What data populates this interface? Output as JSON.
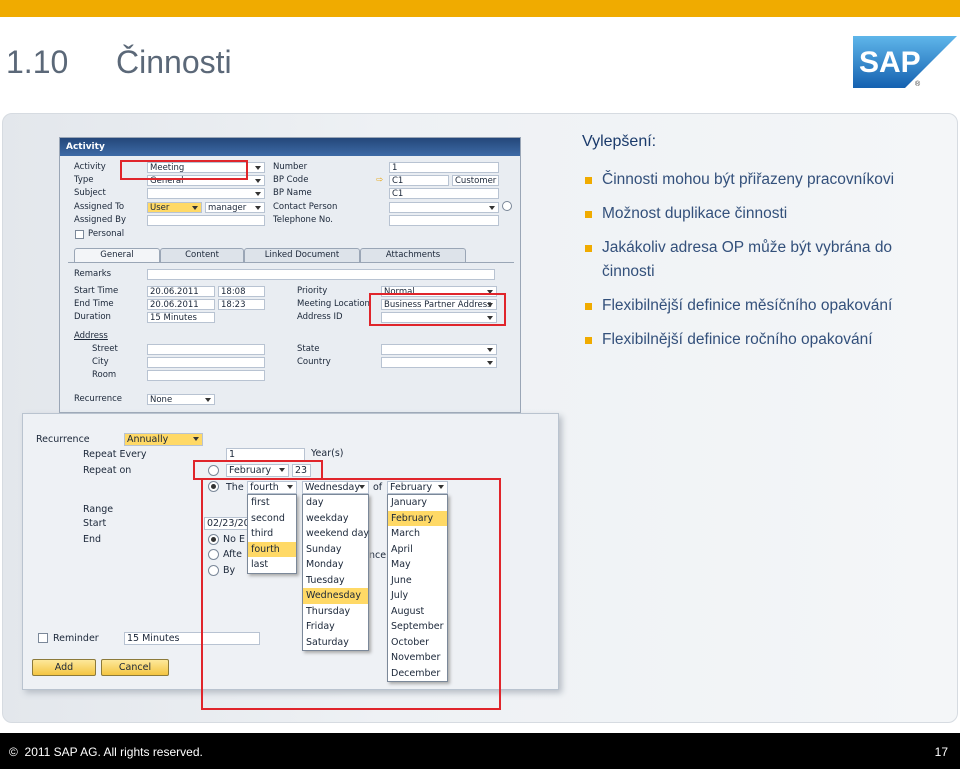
{
  "slide": {
    "number": "1.10",
    "title": "Činnosti",
    "logo_text": "SAP",
    "improvements_title": "Vylepšení:",
    "bullets": [
      "Činnosti mohou být přiřazeny pracovníkovi",
      "Možnost duplikace činnosti",
      "Jakákoliv adresa OP může být vybrána do činnosti",
      "Flexibilnější  definice měsíčního opakování",
      "Flexibilnější  definice ročního opakování"
    ],
    "footer_copyright": "2011 SAP AG. All rights reserved.",
    "page_number": "17",
    "accent_color": "#f0ab00",
    "highlight_box_color": "#e0252b"
  },
  "activity": {
    "window_title": "Activity",
    "labels": {
      "activity": "Activity",
      "type": "Type",
      "subject": "Subject",
      "assigned_to": "Assigned To",
      "assigned_by": "Assigned By",
      "personal": "Personal",
      "number": "Number",
      "bp_code": "BP Code",
      "bp_name": "BP Name",
      "contact_person": "Contact Person",
      "telephone": "Telephone No.",
      "remarks": "Remarks",
      "start_time": "Start Time",
      "end_time": "End Time",
      "duration": "Duration",
      "priority": "Priority",
      "meeting_location": "Meeting Location",
      "address_id": "Address ID",
      "address": "Address",
      "street": "Street",
      "city": "City",
      "room": "Room",
      "state": "State",
      "country": "Country",
      "recurrence": "Recurrence"
    },
    "values": {
      "activity": "Meeting",
      "type": "General",
      "assigned_to_type": "User",
      "assigned_to_user": "manager",
      "number": "1",
      "bp_code": "C1",
      "bp_code_type": "Customer",
      "bp_name": "C1",
      "start_date": "20.06.2011",
      "start_time": "18:08",
      "end_date": "20.06.2011",
      "end_time": "18:23",
      "duration": "15 Minutes",
      "priority": "Normal",
      "meeting_location": "Business Partner Address",
      "recurrence": "None"
    },
    "tabs": [
      "General",
      "Content",
      "Linked Document",
      "Attachments"
    ]
  },
  "recurrence": {
    "labels": {
      "recurrence": "Recurrence",
      "repeat_every": "Repeat Every",
      "repeat_on": "Repeat on",
      "year_unit": "Year(s)",
      "the": "The",
      "of": "of",
      "range": "Range",
      "start": "Start",
      "end": "End",
      "no_end": "No E",
      "after": "Afte",
      "by": "By",
      "occurrence_frag": "nce",
      "reminder": "Reminder"
    },
    "values": {
      "recurrence": "Annually",
      "repeat_every": "1",
      "repeat_on_month": "February",
      "repeat_on_day": "23",
      "ordinal": "fourth",
      "weekday": "Wednesday",
      "month": "February",
      "start_date": "02/23/201",
      "reminder": "15 Minutes"
    },
    "ordinal_options": [
      "first",
      "second",
      "third",
      "fourth",
      "last"
    ],
    "weekday_options": [
      "day",
      "weekday",
      "weekend day",
      "Sunday",
      "Monday",
      "Tuesday",
      "Wednesday",
      "Thursday",
      "Friday",
      "Saturday"
    ],
    "month_options": [
      "January",
      "February",
      "March",
      "April",
      "May",
      "June",
      "July",
      "August",
      "September",
      "October",
      "November",
      "December"
    ],
    "buttons": {
      "add": "Add",
      "cancel": "Cancel"
    }
  }
}
